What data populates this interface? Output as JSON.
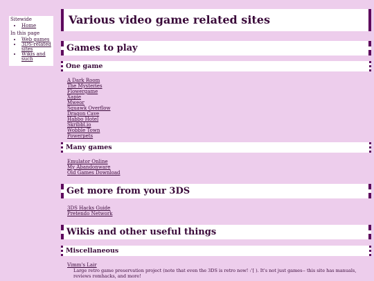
{
  "sidebar": {
    "sitewide_heading": "Sitewide",
    "sitewide_links": [
      "Home"
    ],
    "page_heading": "In this page",
    "page_links": [
      "Web games",
      "3DS-related sites",
      "Wikis and such"
    ]
  },
  "main": {
    "title": "Various video game related sites",
    "sections": [
      {
        "heading": "Games to play"
      },
      {
        "heading": "Get more from your 3DS"
      },
      {
        "heading": "Wikis and other useful things"
      }
    ],
    "subsections": [
      {
        "heading": "One game",
        "links": [
          "A Dark Room",
          "The Mysteries",
          "Flowergame",
          "Xapie",
          "Mweor",
          "Squawk Overflow",
          "Dragon Cave",
          "Habbo Hotel",
          "Skribbl.io",
          "Wobble Town",
          "Powerpets"
        ]
      },
      {
        "heading": "Many games",
        "links": [
          "Emulator Online",
          "My Abandonware",
          "Old Games Download"
        ]
      },
      {
        "heading": "Miscellaneous",
        "links": [
          "Vimm's Lair"
        ],
        "description": "Large retro game preservation project (note that even the 3DS is retro now! :'[ ). It's not just games-- this site has manuals, reviews romhacks, and more!"
      }
    ],
    "threeds_links": [
      "3DS Hacks Guide",
      "Pretendo Network"
    ]
  }
}
